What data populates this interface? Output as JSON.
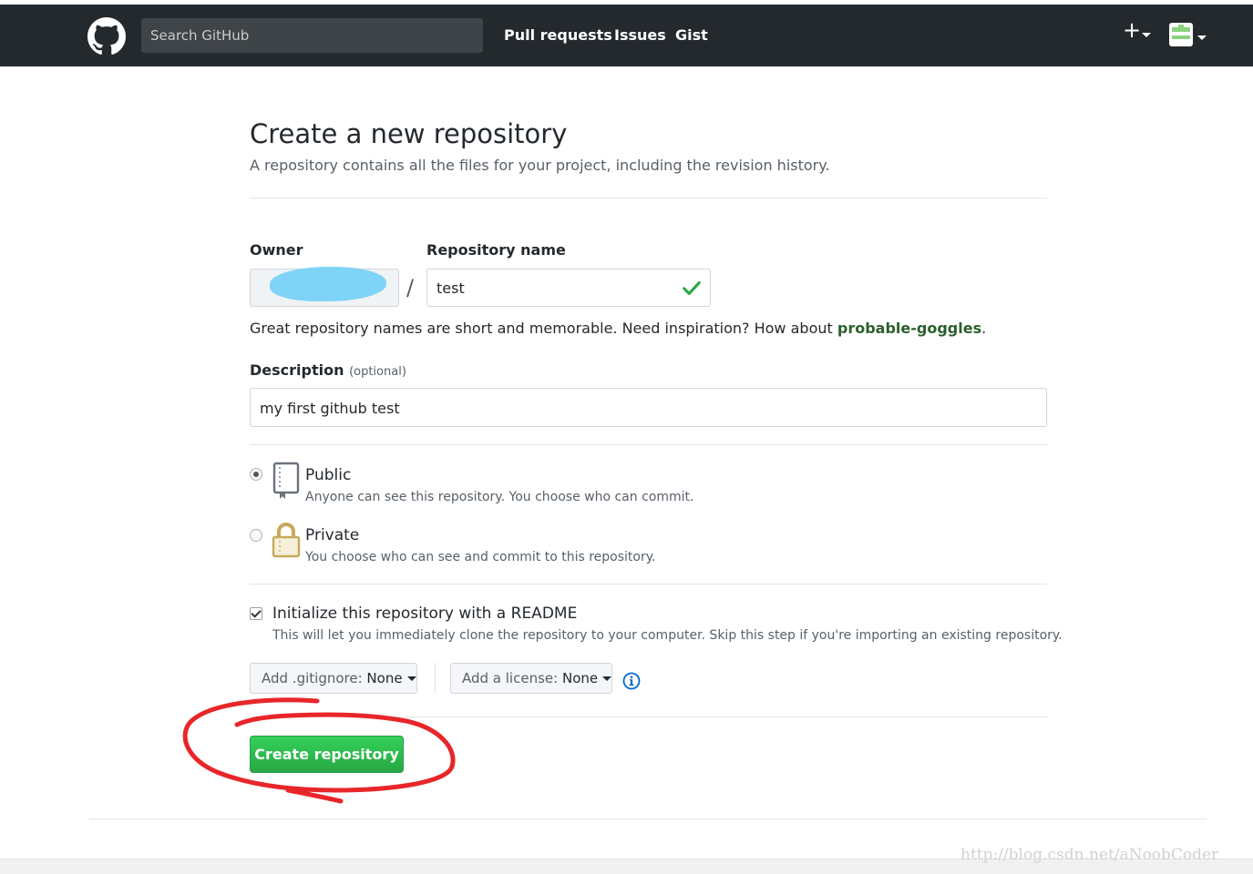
{
  "header": {
    "search_placeholder": "Search GitHub",
    "nav": [
      "Pull requests",
      "Issues",
      "Gist"
    ],
    "new_icon": "plus-icon",
    "logo_icon": "github-octocat-icon"
  },
  "page": {
    "title": "Create a new repository",
    "subtitle": "A repository contains all the files for your project, including the revision history."
  },
  "form": {
    "owner_label": "Owner",
    "repo_label": "Repository name",
    "separator": "/",
    "repo_value": "test",
    "hint_prefix": "Great repository names are short and memorable. Need inspiration? How about ",
    "hint_suggestion": "probable-goggles",
    "hint_suffix": ".",
    "description_label": "Description",
    "description_optional": "(optional)",
    "description_value": "my first github test",
    "visibility": {
      "selected": "Public",
      "options": [
        {
          "title": "Public",
          "desc": "Anyone can see this repository. You choose who can commit."
        },
        {
          "title": "Private",
          "desc": "You choose who can see and commit to this repository."
        }
      ]
    },
    "init_readme": {
      "checked": true,
      "title": "Initialize this repository with a README",
      "desc": "This will let you immediately clone the repository to your computer. Skip this step if you're importing an existing repository."
    },
    "gitignore": {
      "label": "Add .gitignore:",
      "value": "None"
    },
    "license": {
      "label": "Add a license:",
      "value": "None"
    },
    "submit_label": "Create repository"
  },
  "watermark": "http://blog.csdn.net/aNoobCoder",
  "colors": {
    "header_bg": "#24292e",
    "primary_green": "#28a745",
    "annotation_red": "#e8262a"
  }
}
